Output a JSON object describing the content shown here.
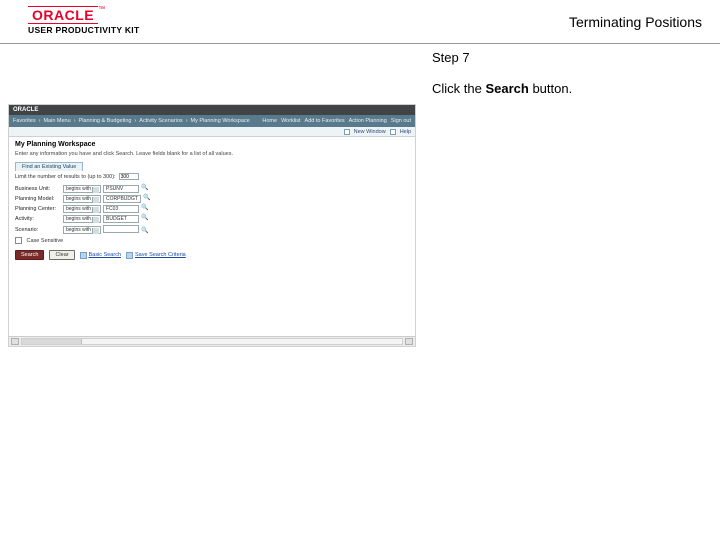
{
  "header": {
    "brand_word": "ORACLE",
    "brand_tm": "™",
    "upk_sub": "USER PRODUCTIVITY KIT",
    "page_title": "Terminating Positions"
  },
  "instructions": {
    "step_label": "Step 7",
    "step_text_prefix": "Click the ",
    "step_text_bold": "Search",
    "step_text_suffix": " button."
  },
  "app": {
    "logo": "ORACLE",
    "breadcrumbs": [
      "Favorites",
      "Main Menu",
      "Planning & Budgeting",
      "Activity Scenarios",
      "My Planning Workspace"
    ],
    "right_links": [
      "Home",
      "Worklist",
      "Add to Favorites",
      "Action Planning",
      "Sign out"
    ],
    "subbar": {
      "new_window": "New Window",
      "help": "Help"
    },
    "page_heading": "My Planning Workspace",
    "page_hint": "Enter any information you have and click Search. Leave fields blank for a list of all values.",
    "tab_label": "Find an Existing Value",
    "limit_label": "Limit the number of results to (up to 300):",
    "limit_value": "300",
    "fields": {
      "business_unit": {
        "label": "Business Unit:",
        "op": "begins with",
        "value": "PSUNV"
      },
      "planning_model": {
        "label": "Planning Model:",
        "op": "begins with",
        "value": "CORPBUDGT"
      },
      "planning_center": {
        "label": "Planning Center:",
        "op": "begins with",
        "value": "FC03"
      },
      "activity": {
        "label": "Activity:",
        "op": "begins with",
        "value": "BUDGET"
      },
      "scenario": {
        "label": "Scenario:",
        "op": "begins with",
        "value": ""
      }
    },
    "case_sensitive_label": "Case Sensitive",
    "buttons": {
      "search": "Search",
      "clear": "Clear"
    },
    "links": {
      "basic": "Basic Search",
      "save": "Save Search Criteria"
    }
  }
}
